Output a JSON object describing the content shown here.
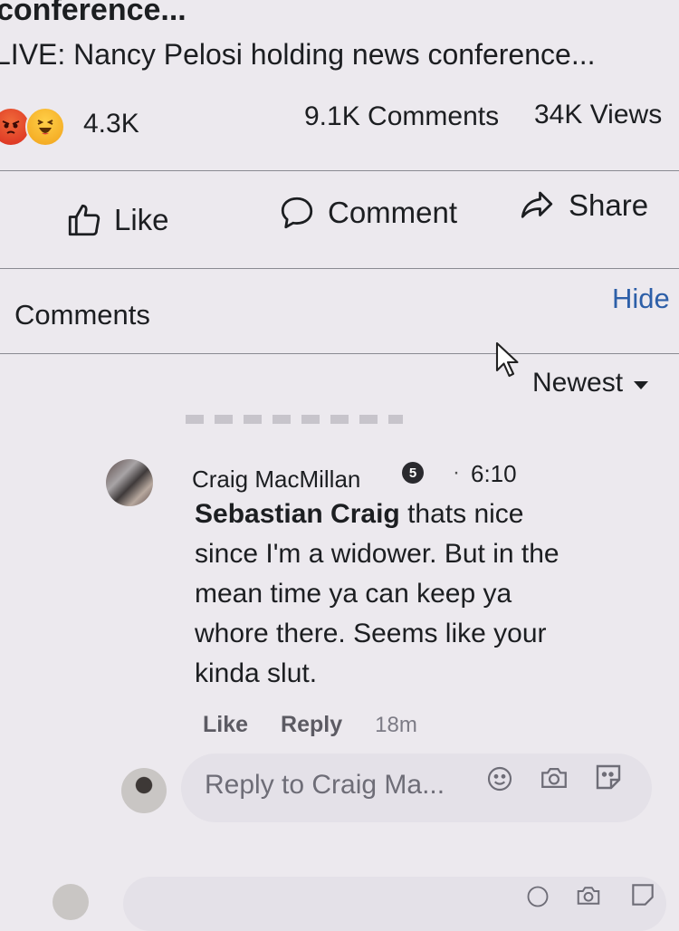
{
  "post": {
    "title": "conference...",
    "subtitle": "LIVE: Nancy Pelosi holding news conference...",
    "reactions": {
      "icons": [
        "angry-icon",
        "haha-icon"
      ],
      "count": "4.3K"
    },
    "comments_count": "9.1K Comments",
    "views_count": "34K Views"
  },
  "actions": {
    "like": "Like",
    "comment": "Comment",
    "share": "Share"
  },
  "comments_section": {
    "label": "Comments",
    "hide": "Hide",
    "sort": "Newest"
  },
  "comment": {
    "author": "Craig MacMillan",
    "badge": "5",
    "separator": "·",
    "time": "6:10",
    "mention": "Sebastian Craig",
    "text": " thats nice since I'm a widower. But in the mean time ya can keep ya whore there. Seems like your kinda slut.",
    "like": "Like",
    "reply": "Reply",
    "age": "18m"
  },
  "reply_box": {
    "placeholder": "Reply to Craig Ma..."
  },
  "colors": {
    "background": "#ece9ee",
    "link": "#2d5fa8",
    "text": "#1c1e21"
  }
}
